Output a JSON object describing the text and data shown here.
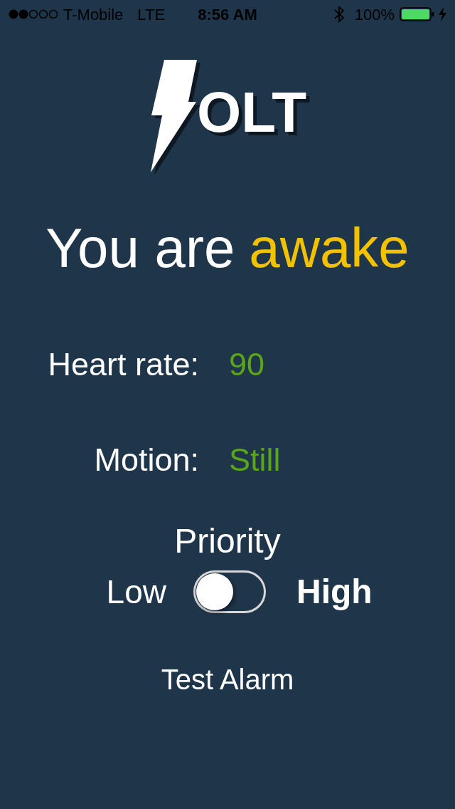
{
  "status_bar": {
    "carrier": "T-Mobile",
    "network": "LTE",
    "time": "8:56 AM",
    "battery_percent": "100%"
  },
  "logo": {
    "text": "OLT"
  },
  "status": {
    "prefix": "You are",
    "value": "awake"
  },
  "readings": [
    {
      "label": "Heart rate:",
      "value": "90"
    },
    {
      "label": "Motion:",
      "value": "Still"
    }
  ],
  "priority": {
    "title": "Priority",
    "low_label": "Low",
    "high_label": "High",
    "on": false
  },
  "test_alarm": {
    "label": "Test Alarm"
  }
}
